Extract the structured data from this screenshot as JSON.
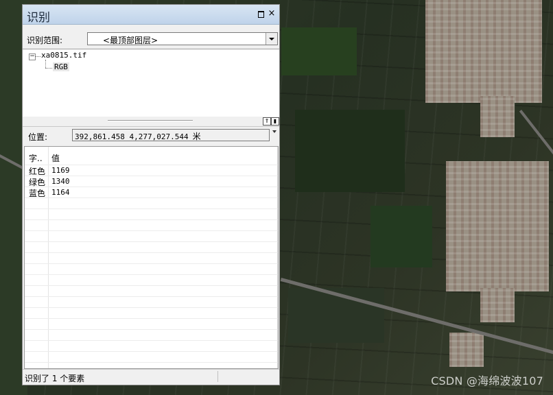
{
  "window": {
    "title": "识别",
    "restore_label": "",
    "close_label": "×"
  },
  "scope": {
    "label": "识别范围:",
    "selected": "<最顶部图层>"
  },
  "tree": {
    "expander": "−",
    "file": "xa0815.tif",
    "child": "RGB"
  },
  "splitter": {
    "top_btn": "⇑",
    "side_btn": "▮"
  },
  "location": {
    "label": "位置:",
    "value": "392,861.458  4,277,027.544",
    "unit": "米"
  },
  "grid": {
    "header_field": "字..",
    "header_value": "值",
    "rows": [
      {
        "field": "红色",
        "value": "1169"
      },
      {
        "field": "绿色",
        "value": "1340"
      },
      {
        "field": "蓝色",
        "value": "1164"
      }
    ]
  },
  "status": {
    "text": "识别了 1 个要素"
  },
  "watermark": "CSDN @海绵波波107"
}
